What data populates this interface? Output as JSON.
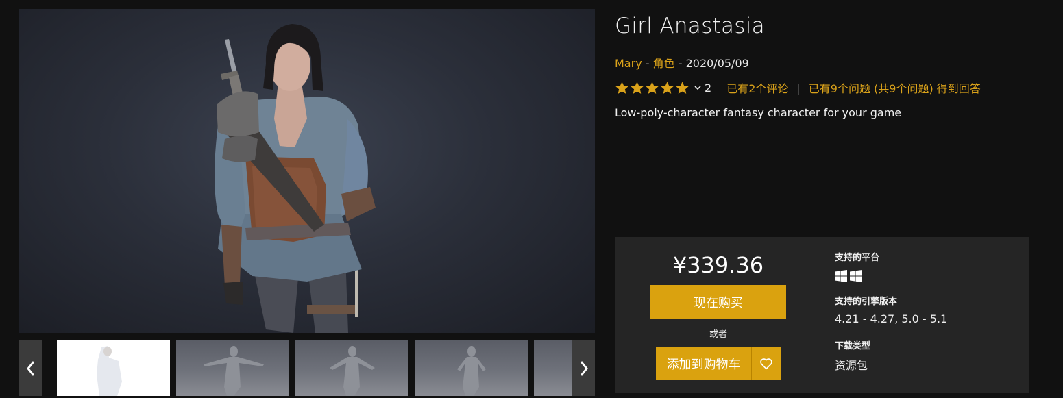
{
  "product": {
    "title": "Girl Anastasia",
    "author": "Mary",
    "meta_sep_1": " - ",
    "category": "角色",
    "meta_sep_2": " - ",
    "date": "2020/05/09",
    "rating": 5,
    "rating_count": "2",
    "reviews_link": "已有2个评论",
    "questions_link": "已有9个问题 (共9个问题) 得到回答",
    "description": "Low-poly-character fantasy character for your game"
  },
  "purchase": {
    "price": "¥339.36",
    "buy_now_label": "现在购买",
    "or_label": "或者",
    "add_to_cart_label": "添加到购物车",
    "wishlist_icon": "heart-icon"
  },
  "specs": {
    "platforms_label": "支持的平台",
    "platforms": [
      "windows-icon",
      "windows-icon"
    ],
    "engine_label": "支持的引擎版本",
    "engine_value": "4.21 - 4.27, 5.0 - 5.1",
    "download_label": "下载类型",
    "download_value": "资源包"
  },
  "gallery": {
    "prev_icon": "chevron-left-icon",
    "next_icon": "chevron-right-icon",
    "thumbnails": [
      "thumbnail-1",
      "thumbnail-2",
      "thumbnail-3",
      "thumbnail-4",
      "thumbnail-5"
    ],
    "active_index": 0
  },
  "colors": {
    "accent": "#daa21a",
    "button": "#daa20f",
    "background": "#111111",
    "panel": "#252525"
  }
}
